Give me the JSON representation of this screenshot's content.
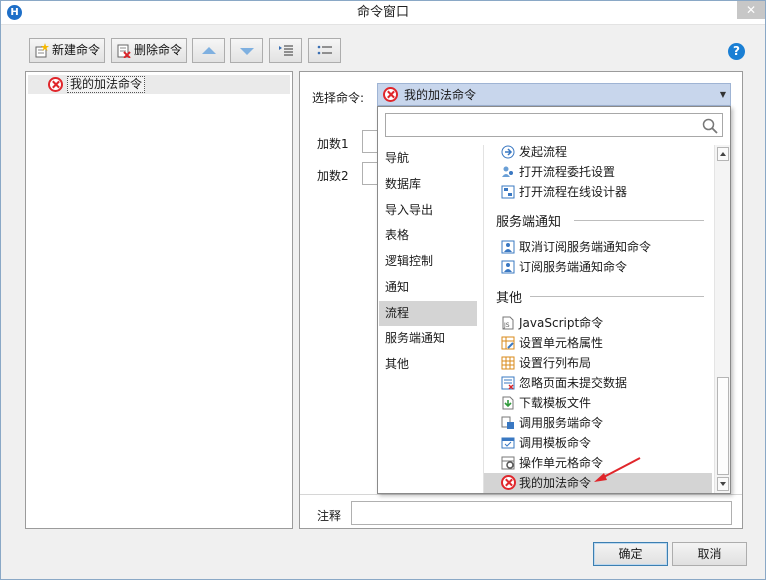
{
  "window": {
    "title": "命令窗口",
    "app_icon": "H",
    "close_glyph": "✕"
  },
  "toolbar": {
    "new_label": "新建命令",
    "delete_label": "删除命令",
    "help_glyph": "?"
  },
  "tree": {
    "items": [
      {
        "label": "我的加法命令"
      }
    ]
  },
  "editor": {
    "select_label": "选择命令:",
    "selected_value": "我的加法命令",
    "params": [
      {
        "label": "加数1"
      },
      {
        "label": "加数2"
      }
    ],
    "notes_label": "注释"
  },
  "popup": {
    "search_placeholder": "",
    "categories": [
      "导航",
      "数据库",
      "导入导出",
      "表格",
      "逻辑控制",
      "通知",
      "流程",
      "服务端通知",
      "其他"
    ],
    "active_category": "流程",
    "flow_items": [
      "发起流程",
      "打开流程委托设置",
      "打开流程在线设计器"
    ],
    "groups": {
      "server": "服务端通知",
      "other": "其他"
    },
    "server_items": [
      "取消订阅服务端通知命令",
      "订阅服务端通知命令"
    ],
    "other_items": [
      "JavaScript命令",
      "设置单元格属性",
      "设置行列布局",
      "忽略页面未提交数据",
      "下载模板文件",
      "调用服务端命令",
      "调用模板命令",
      "操作单元格命令",
      "我的加法命令"
    ]
  },
  "buttons": {
    "ok": "确定",
    "cancel": "取消"
  },
  "colors": {
    "accent": "#1e6fc8",
    "error": "#e0262b",
    "selection": "#c8d6ec"
  }
}
